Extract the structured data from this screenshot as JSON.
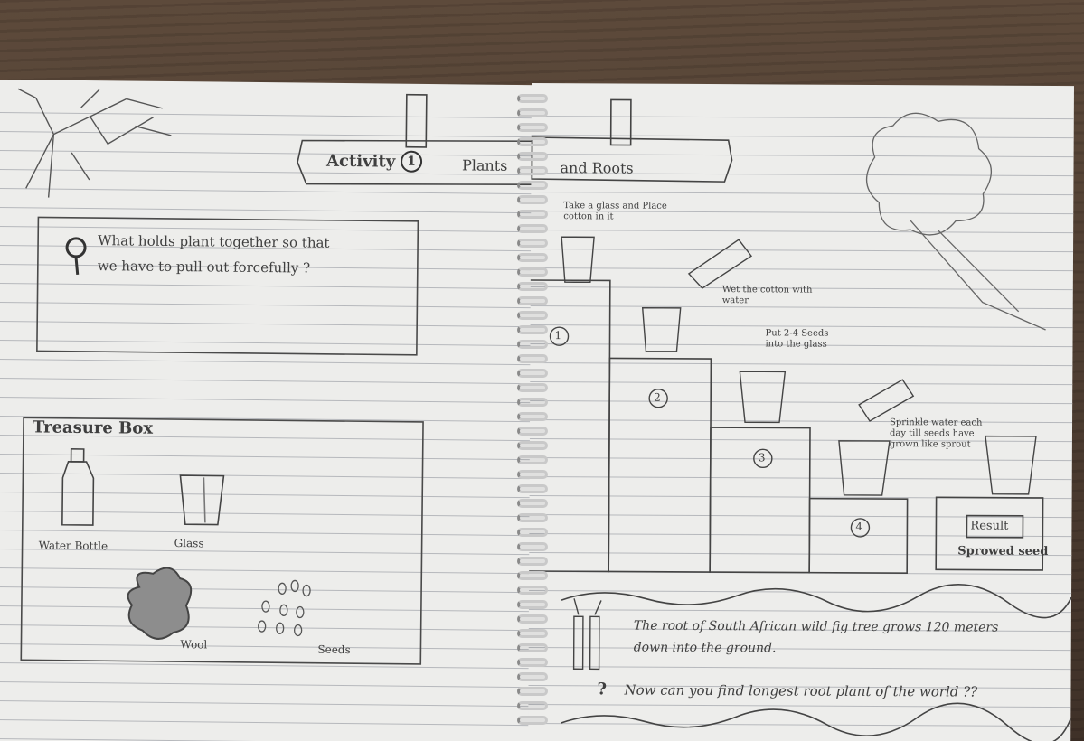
{
  "header": {
    "activity_label": "Activity",
    "activity_number": "1",
    "title_part1": "Plants",
    "title_part2": "and Roots"
  },
  "question": {
    "line1": "What holds plant together so that",
    "line2": "we have to pull out forcefully ?"
  },
  "treasure_box": {
    "title": "Treasure Box",
    "items": [
      {
        "label": "Water Bottle",
        "icon": "water-bottle-icon"
      },
      {
        "label": "Glass",
        "icon": "glass-icon"
      },
      {
        "label": "Wool",
        "icon": "wool-icon"
      },
      {
        "label": "Seeds",
        "icon": "seeds-icon"
      }
    ]
  },
  "steps": [
    {
      "number": "1",
      "text": "Take a glass and Place cotton in it"
    },
    {
      "number": "2",
      "text": "Wet the cotton with water"
    },
    {
      "number": "3",
      "text": "Put 2-4 Seeds into the glass"
    },
    {
      "number": "4",
      "text": "Sprinkle water each day till seeds have grown like sprout"
    }
  ],
  "result": {
    "label": "Result",
    "caption": "Sprowed seed"
  },
  "fact": {
    "line1": "The root of South African wild fig tree grows 120 meters",
    "line2": "down into the ground.",
    "question_mark": "?",
    "question": "Now can you find longest root plant of the world ??"
  },
  "colors": {
    "paper": "#ededeb",
    "rule_line": "#b6b8bc",
    "pencil": "#3f3f3f",
    "desk": "#4a3a2e"
  }
}
